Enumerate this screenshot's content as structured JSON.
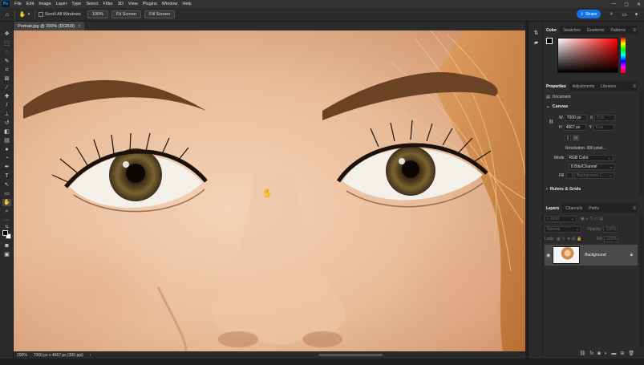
{
  "menu": {
    "logo": "Ps",
    "items": [
      "File",
      "Edit",
      "Image",
      "Layer",
      "Type",
      "Select",
      "Filter",
      "3D",
      "View",
      "Plugins",
      "Window",
      "Help"
    ],
    "window_controls": [
      "—",
      "▢",
      "✕"
    ]
  },
  "options": {
    "hand_icon": "hand-icon",
    "scroll_all_windows": "Scroll All Windows",
    "zoom_100": "100%",
    "fit_screen": "Fit Screen",
    "fill_screen": "Fill Screen",
    "share": "Share"
  },
  "document": {
    "tab_title": "Portrait.jpg @ 200% (RGB/8)",
    "tab_close": "×"
  },
  "status": {
    "zoom": "200%",
    "dimensions": "7000 px x 4667 px (300 ppi)",
    "arrow": "›"
  },
  "color_panel": {
    "tabs": [
      "Color",
      "Swatches",
      "Gradients",
      "Patterns"
    ],
    "active_tab": 0,
    "foreground": "#000000",
    "background": "#ffffff"
  },
  "properties_panel": {
    "tabs": [
      "Properties",
      "Adjustments",
      "Libraries"
    ],
    "active_tab": 0,
    "document_label": "Document",
    "canvas_section": "Canvas",
    "w_label": "W",
    "w_value": "7000 px",
    "h_label": "H",
    "h_value": "4667 px",
    "x_label": "X",
    "x_value": "0 px",
    "y_label": "Y",
    "y_value": "0 px",
    "resolution": "Resolution: 300 pixel...",
    "mode_label": "Mode",
    "mode_value": "RGB Color",
    "bit_depth": "8 Bits/Channel",
    "fill_label": "Fill",
    "fill_value": "Background C...",
    "rulers_section": "Rulers & Grids"
  },
  "layers_panel": {
    "tabs": [
      "Layers",
      "Channels",
      "Paths"
    ],
    "active_tab": 0,
    "kind_placeholder": "Kind",
    "blend_mode": "Normal",
    "opacity_label": "Opacity:",
    "opacity_value": "100%",
    "lock_label": "Lock:",
    "fill_label": "Fill:",
    "fill_value": "100%",
    "layers": [
      {
        "name": "Background",
        "visible": true,
        "locked": true
      }
    ],
    "footer_icons": [
      "link-icon",
      "fx-icon",
      "mask-icon",
      "adjustment-icon",
      "group-icon",
      "new-layer-icon",
      "trash-icon"
    ]
  },
  "tools": [
    "move-icon",
    "marquee-icon",
    "lasso-icon",
    "quick-select-icon",
    "crop-icon",
    "frame-icon",
    "eyedropper-icon",
    "healing-brush-icon",
    "brush-icon",
    "clone-stamp-icon",
    "history-brush-icon",
    "eraser-icon",
    "gradient-icon",
    "blur-icon",
    "dodge-icon",
    "pen-icon",
    "type-icon",
    "path-select-icon",
    "rectangle-icon",
    "hand-icon",
    "zoom-icon",
    "more-tools-icon"
  ],
  "colors": {
    "chrome_dark": "#2b2b2b",
    "chrome_menu": "#323232",
    "accent": "#1473e6"
  }
}
